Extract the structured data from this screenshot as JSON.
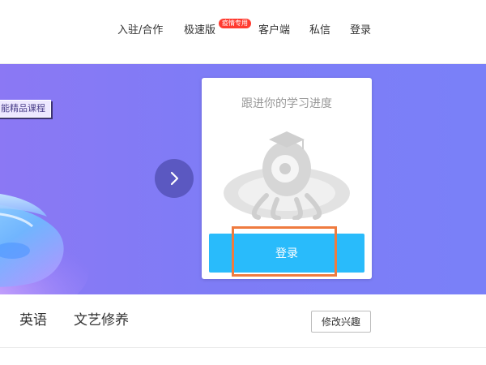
{
  "nav": {
    "items": [
      {
        "label": "入驻/合作"
      },
      {
        "label": "极速版"
      },
      {
        "label": "客户端"
      },
      {
        "label": "私信"
      },
      {
        "label": "登录"
      }
    ],
    "badge": "疫情专用"
  },
  "banner": {
    "course_tag": "能精品课程"
  },
  "login_card": {
    "tip": "跟进你的学习进度",
    "login_button": "登录"
  },
  "interests": {
    "tabs": [
      {
        "label": "英语"
      },
      {
        "label": "文艺修养"
      }
    ],
    "modify_button": "修改兴趣"
  },
  "colors": {
    "banner": "#7e7cf6",
    "login_button": "#29bbfb",
    "highlight": "#ef7b3f",
    "badge": "#ff3b30"
  }
}
